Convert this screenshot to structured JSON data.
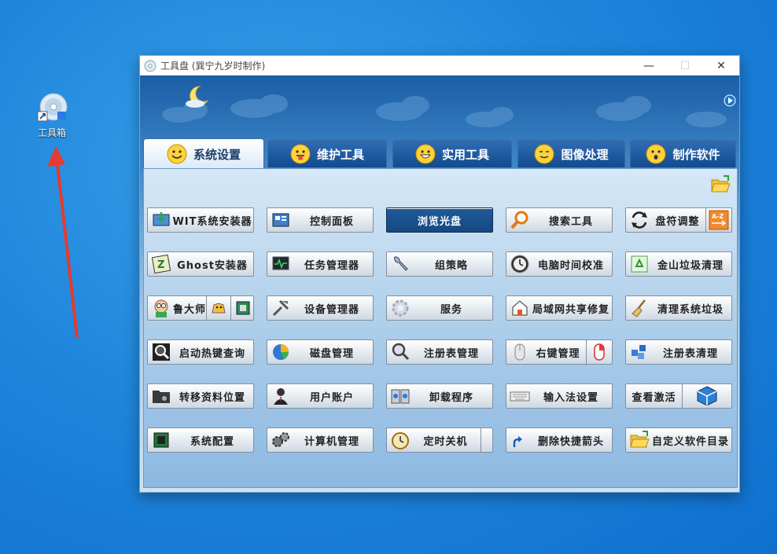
{
  "desktop": {
    "icon_label": "工具箱"
  },
  "window": {
    "title": "工具盘 (巽宁九岁时制作)"
  },
  "tabs": [
    {
      "label": "系统设置",
      "active": true
    },
    {
      "label": "维护工具",
      "active": false
    },
    {
      "label": "实用工具",
      "active": false
    },
    {
      "label": "图像处理",
      "active": false
    },
    {
      "label": "制作软件",
      "active": false
    }
  ],
  "buttons": {
    "r1": [
      "WIT系统安装器",
      "控制面板",
      "浏览光盘",
      "搜索工具",
      "盘符调整"
    ],
    "r2": [
      "Ghost安装器",
      "任务管理器",
      "组策略",
      "电脑时间校准",
      "金山垃圾清理"
    ],
    "r3": [
      "鲁大师",
      "设备管理器",
      "服务",
      "局域网共享修复",
      "清理系统垃圾"
    ],
    "r4": [
      "启动热键查询",
      "磁盘管理",
      "注册表管理",
      "右键管理",
      "注册表清理"
    ],
    "r5": [
      "转移资料位置",
      "用户账户",
      "卸载程序",
      "输入法设置",
      "查看激活"
    ],
    "r6": [
      "系统配置",
      "计算机管理",
      "定时关机",
      "删除快捷箭头",
      "自定义软件目录"
    ]
  },
  "colors": {
    "accent": "#1e5a99",
    "arrow": "#e53a2f"
  }
}
